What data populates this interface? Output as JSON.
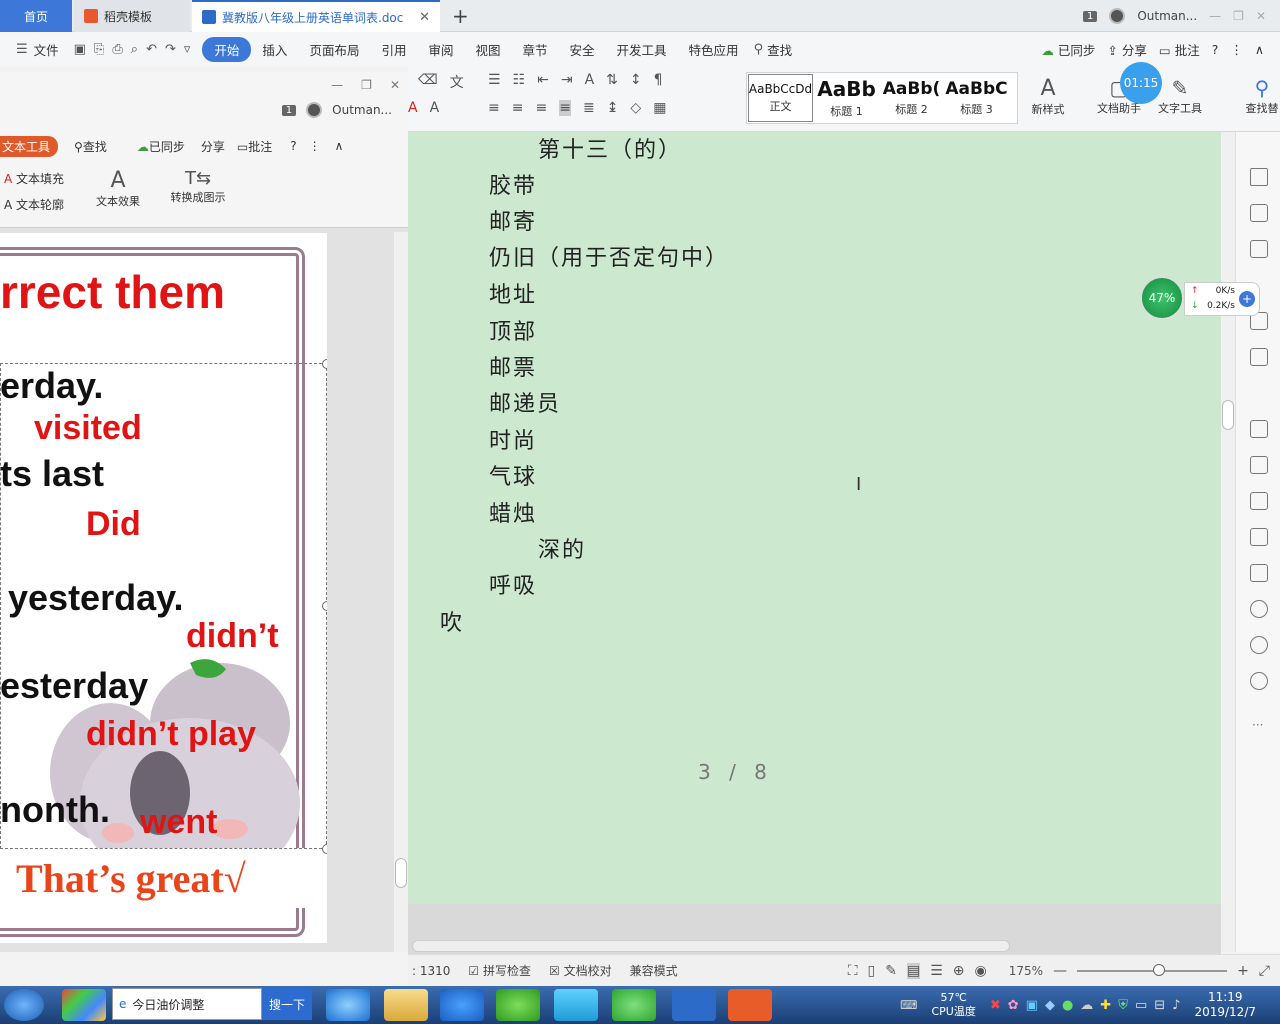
{
  "tabs": {
    "home": "首页",
    "template": "稻壳模板",
    "doc": "冀教版八年级上册英语单词表.doc",
    "badge": "1",
    "user": "Outman..."
  },
  "menu": {
    "file": "文件",
    "items": [
      "开始",
      "插入",
      "页面布局",
      "引用",
      "审阅",
      "视图",
      "章节",
      "安全",
      "开发工具",
      "特色应用"
    ],
    "find": "查找",
    "synced": "已同步",
    "share": "分享",
    "comment": "批注"
  },
  "toolbar": {
    "styles": [
      {
        "sample": "AaBbCcDd",
        "label": "正文"
      },
      {
        "sample": "AaBb",
        "label": "标题 1"
      },
      {
        "sample": "AaBb(",
        "label": "标题 2"
      },
      {
        "sample": "AaBbC",
        "label": "标题 3"
      }
    ],
    "new_style": "新样式",
    "doc_assistant": "文档助手",
    "text_tools": "文字工具",
    "find_replace": "查找替"
  },
  "timer": "01:15",
  "document": {
    "lines": [
      "第十三（的）",
      "胶带",
      "邮寄",
      "仍旧（用于否定句中）",
      "地址",
      "顶部",
      "邮票",
      "邮递员",
      "时尚",
      "气球",
      "蜡烛",
      "深的",
      "呼吸",
      "吹"
    ],
    "page": "3 / 8"
  },
  "net_gauge": {
    "percent": "47%",
    "up": "0K/s",
    "down": "0.2K/s"
  },
  "statusbar": {
    "words": ": 1310",
    "spell": "拼写检查",
    "proof": "文档校对",
    "compat": "兼容模式",
    "zoom": "175%"
  },
  "float_window": {
    "badge": "1",
    "user": "Outman...",
    "tab_label": "文本工具",
    "find": "查找",
    "synced": "已同步",
    "share": "分享",
    "comment": "批注",
    "text_fill": "文本填充",
    "text_outline": "文本轮廓",
    "text_effect": "文本效果",
    "convert": "转换成图示"
  },
  "slide": {
    "title": "rrect them",
    "rows": [
      {
        "text": "erday.",
        "color": "black"
      },
      {
        "text": "visited",
        "color": "red"
      },
      {
        "text": "ts last",
        "color": "black"
      },
      {
        "text": "Did",
        "color": "red"
      },
      {
        "text": "yesterday.",
        "color": "black"
      },
      {
        "text": "didn’t",
        "color": "red"
      },
      {
        "text": "esterday",
        "color": "black"
      },
      {
        "text": "didn’t  play",
        "color": "red"
      },
      {
        "text": "nonth.",
        "color": "black"
      },
      {
        "text": "went",
        "color": "red"
      }
    ],
    "footer": "That’s great√"
  },
  "taskbar": {
    "search_text": "今日油价调整",
    "search_button": "搜一下",
    "temp": "57℃",
    "temp_label": "CPU温度",
    "time": "11:19",
    "date": "2019/12/7"
  }
}
